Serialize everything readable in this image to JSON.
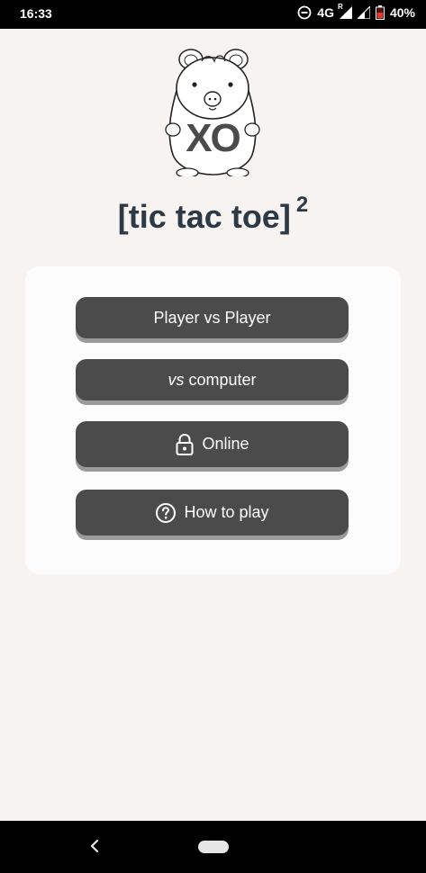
{
  "status_bar": {
    "time": "16:33",
    "network": "4G",
    "roaming_mark": "R",
    "battery_percent": "40%",
    "icons": [
      "do-not-disturb-icon",
      "signal-icon",
      "signal-icon",
      "battery-icon"
    ]
  },
  "app": {
    "logo_text": "XO",
    "title": "[tic tac toe]",
    "title_superscript": "2",
    "menu": {
      "player_vs_player": "Player vs Player",
      "vs_prefix": "vs",
      "vs_computer": "computer",
      "online": "Online",
      "how_to_play": "How to play"
    },
    "icons": {
      "online": "lock-icon",
      "how_to_play": "help-circle-icon"
    }
  },
  "navigation": {
    "back": "back-icon",
    "home": "home-pill"
  },
  "colors": {
    "background": "#f6f3f1",
    "card": "#fdfcfc",
    "button": "#4b4b4b",
    "button_shadow": "#9a9a9a",
    "title": "#2d3a45"
  }
}
